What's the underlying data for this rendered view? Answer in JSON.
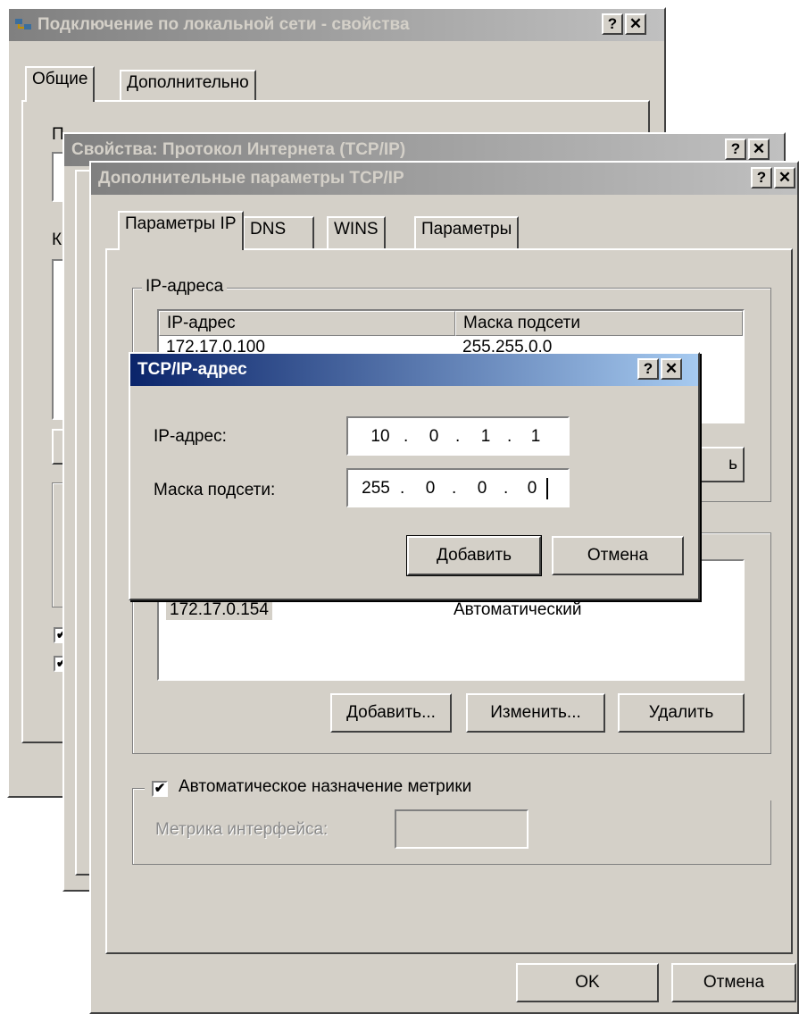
{
  "window1": {
    "title": "Подключение по локальной сети - свойства",
    "help": "?",
    "close": "✕",
    "tabs": [
      "Общие",
      "Дополнительно"
    ],
    "partial_letters": [
      "П",
      "К"
    ]
  },
  "window2": {
    "title": "Свойства: Протокол Интернета (TCP/IP)",
    "help": "?",
    "close": "✕"
  },
  "window3": {
    "title": "Дополнительные параметры TCP/IP",
    "help": "?",
    "close": "✕",
    "tabs": [
      "Параметры IP",
      "DNS",
      "WINS",
      "Параметры"
    ],
    "ip_group": {
      "legend": "IP-адреса",
      "columns": [
        "IP-адрес",
        "Маска подсети"
      ],
      "rows": [
        {
          "ip": "172.17.0.100",
          "mask": "255.255.0.0"
        }
      ],
      "partial_button": "ь"
    },
    "gw_group": {
      "rows": [
        {
          "gateway": "172.17.0.154",
          "metric": "Автоматический"
        }
      ],
      "add": "Добавить...",
      "edit": "Изменить...",
      "remove": "Удалить"
    },
    "metric": {
      "checkbox_label": "Автоматическое назначение метрики",
      "checked": true,
      "field_label": "Метрика интерфейса:",
      "value": ""
    },
    "ok": "OK",
    "cancel": "Отмена"
  },
  "dialog": {
    "title": "TCP/IP-адрес",
    "help": "?",
    "close": "✕",
    "ip_label": "IP-адрес:",
    "ip_octets": [
      "10",
      "0",
      "1",
      "1"
    ],
    "mask_label": "Маска подсети:",
    "mask_octets": [
      "255",
      "0",
      "0",
      "0"
    ],
    "add": "Добавить",
    "cancel": "Отмена"
  },
  "colors": {
    "active_title": "#0a246a",
    "inactive_title": "#808080",
    "face": "#d4d0c8"
  }
}
